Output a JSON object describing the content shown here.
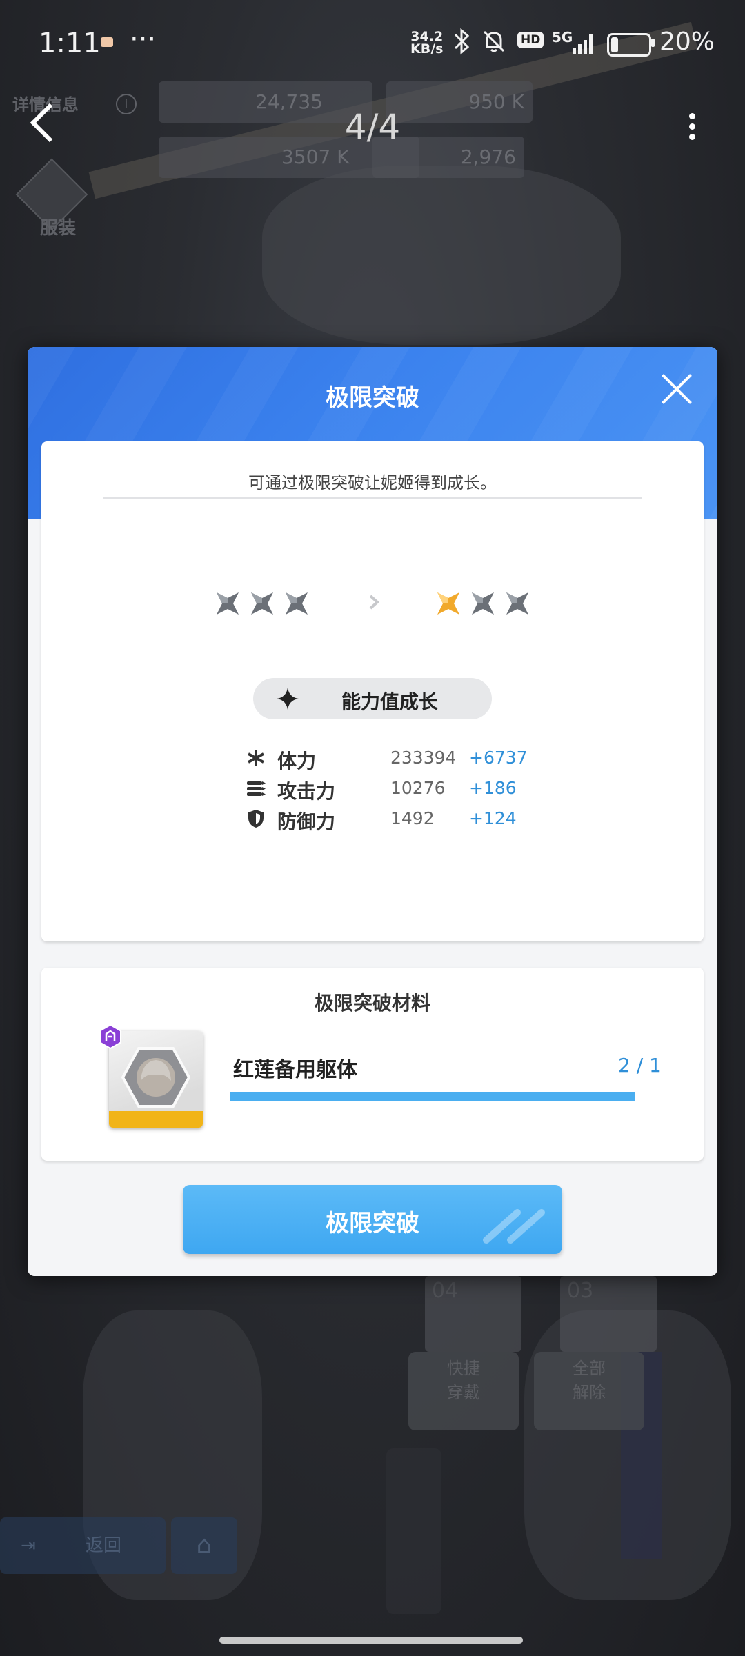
{
  "status_bar": {
    "time": "1:11",
    "dots": "···",
    "net_speed_value": "34.2",
    "net_speed_unit": "KB/s",
    "hd_badge": "HD",
    "network": "5G",
    "battery_percent": "20%",
    "battery_level": 0.2
  },
  "top_bar": {
    "page_indicator": "4/4"
  },
  "background": {
    "detail_info": "详情信息",
    "stat_1": "24,735",
    "stat_2": "950 K",
    "stat_3": "3507 K",
    "stat_4": "2,976",
    "costume": "服装",
    "slot_1": "04",
    "slot_2": "03",
    "quick_equip": "快捷\n穿戴",
    "remove_all": "全部\n解除",
    "back": "返回"
  },
  "dialog": {
    "title": "极限突破",
    "description": "可通过极限突破让妮姬得到成长。",
    "current_stars": 0,
    "next_stars": 1,
    "total_stars": 3,
    "growth_label": "能力值成长",
    "stats": [
      {
        "icon": "asterisk-icon",
        "name": "体力",
        "value": "233394",
        "increase": "+6737"
      },
      {
        "icon": "bullets-icon",
        "name": "攻击力",
        "value": "10276",
        "increase": "+186"
      },
      {
        "icon": "shield-icon",
        "name": "防御力",
        "value": "1492",
        "increase": "+124"
      }
    ],
    "materials_title": "极限突破材料",
    "material": {
      "name": "红莲备用躯体",
      "count": "2 / 1",
      "progress": 1.0
    },
    "action_button": "极限突破"
  },
  "colors": {
    "accent_blue": "#3b82ee",
    "stat_increase": "#2f8fd8",
    "star_active": "#f1a92b",
    "star_inactive": "#6b7077",
    "material_rarity": "#8a3fd6"
  }
}
